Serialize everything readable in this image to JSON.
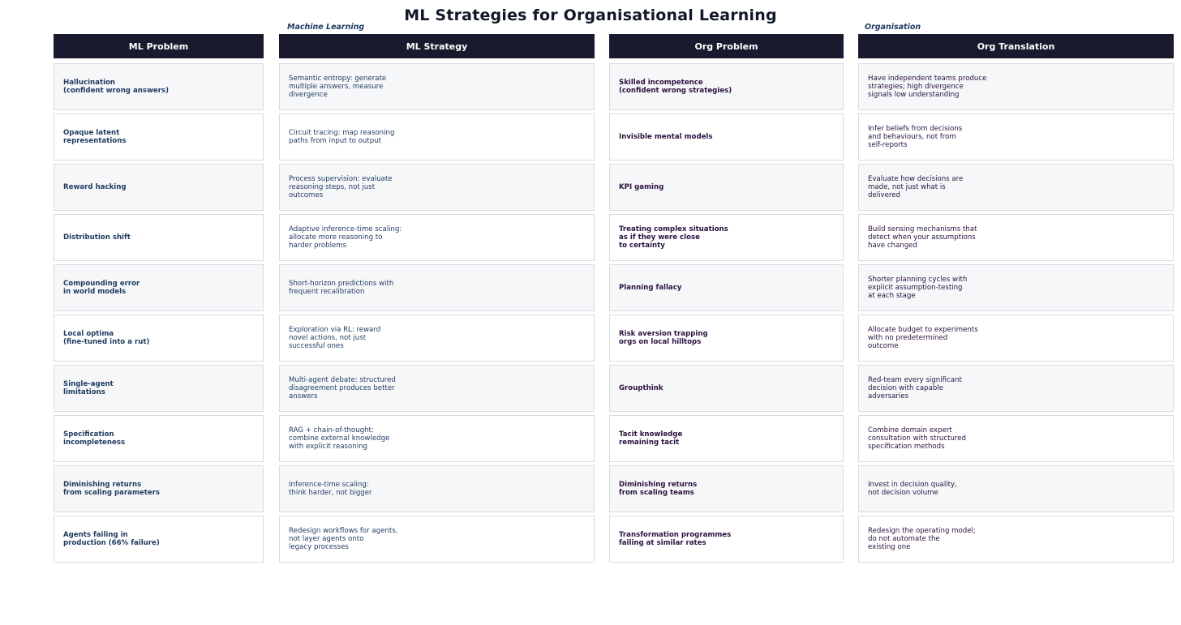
{
  "title": "ML Strategies for Organisational Learning",
  "group_labels": {
    "left": "Machine Learning",
    "right": "Organisation"
  },
  "columns": {
    "ml_problem": {
      "header": "ML Problem",
      "items": [
        "Hallucination\n(confident wrong answers)",
        "Opaque latent\nrepresentations",
        "Reward hacking",
        "Distribution shift",
        "Compounding error\nin world models",
        "Local optima\n(fine-tuned into a rut)",
        "Single-agent\nlimitations",
        "Specification\nincompleteness",
        "Diminishing returns\nfrom scaling parameters",
        "Agents failing in\nproduction (66% failure)"
      ]
    },
    "ml_strategy": {
      "header": "ML Strategy",
      "items": [
        "Semantic entropy: generate\nmultiple answers, measure\ndivergence",
        "Circuit tracing: map reasoning\npaths from input to output",
        "Process supervision: evaluate\nreasoning steps, not just\noutcomes",
        "Adaptive inference-time scaling:\nallocate more reasoning to\nharder problems",
        "Short-horizon predictions with\nfrequent recalibration",
        "Exploration via RL: reward\nnovel actions, not just\nsuccessful ones",
        "Multi-agent debate: structured\ndisagreement produces better\nanswers",
        "RAG + chain-of-thought:\ncombine external knowledge\nwith explicit reasoning",
        "Inference-time scaling:\nthink harder, not bigger",
        "Redesign workflows for agents,\nnot layer agents onto\nlegacy processes"
      ]
    },
    "org_problem": {
      "header": "Org Problem",
      "items": [
        "Skilled incompetence\n(confident wrong strategies)",
        "Invisible mental models",
        "KPI gaming",
        "Treating complex situations\nas if they were close\nto certainty",
        "Planning fallacy",
        "Risk aversion trapping\norgs on local hilltops",
        "Groupthink",
        "Tacit knowledge\nremaining tacit",
        "Diminishing returns\nfrom scaling teams",
        "Transformation programmes\nfailing at similar rates"
      ]
    },
    "org_translation": {
      "header": "Org Translation",
      "items": [
        "Have independent teams produce\nstrategies; high divergence\nsignals low understanding",
        "Infer beliefs from decisions\nand behaviours, not from\nself-reports",
        "Evaluate how decisions are\nmade, not just what is\ndelivered",
        "Build sensing mechanisms that\ndetect when your assumptions\nhave changed",
        "Shorter planning cycles with\nexplicit assumption-testing\nat each stage",
        "Allocate budget to experiments\nwith no predetermined\noutcome",
        "Red-team every significant\ndecision with capable\nadversaries",
        "Combine domain expert\nconsultation with structured\nspecification methods",
        "Invest in decision quality,\nnot decision volume",
        "Redesign the operating model;\ndo not automate the\nexisting one"
      ]
    }
  },
  "colors": {
    "header_bg": "#1a1a2e",
    "ml_text": "#1e3a5f",
    "org_text": "#2a1240",
    "cell_border": "#d7dbe0",
    "shaded_cell": "#f6f7f9"
  }
}
